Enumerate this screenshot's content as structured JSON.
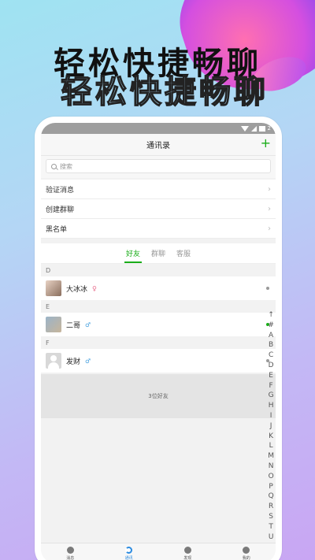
{
  "promo": {
    "headline": "轻松快捷畅聊"
  },
  "status": {
    "time": "2"
  },
  "header": {
    "title": "通讯录",
    "add_icon": "plus-icon"
  },
  "search": {
    "placeholder": "搜索"
  },
  "menu": [
    {
      "label": "验证消息"
    },
    {
      "label": "创建群聊"
    },
    {
      "label": "黑名单"
    }
  ],
  "tabs": [
    {
      "label": "好友",
      "active": true
    },
    {
      "label": "群聊",
      "active": false
    },
    {
      "label": "客服",
      "active": false
    }
  ],
  "sections": [
    {
      "letter": "D",
      "contacts": [
        {
          "name": "大冰冰",
          "gender": "female",
          "online": false
        }
      ]
    },
    {
      "letter": "E",
      "contacts": [
        {
          "name": "二哥",
          "gender": "male",
          "online": true
        }
      ]
    },
    {
      "letter": "F",
      "contacts": [
        {
          "name": "发财",
          "gender": "male",
          "online": false
        }
      ]
    }
  ],
  "friend_count": "3位好友",
  "index_letters": [
    "↑",
    "#",
    "A",
    "B",
    "C",
    "D",
    "E",
    "F",
    "G",
    "H",
    "I",
    "J",
    "K",
    "L",
    "M",
    "N",
    "O",
    "P",
    "Q",
    "R",
    "S",
    "T",
    "U"
  ],
  "bottom_nav": [
    {
      "label": "消息",
      "icon": "message-icon"
    },
    {
      "label": "通讯",
      "icon": "contacts-icon",
      "active": true
    },
    {
      "label": "发现",
      "icon": "discover-icon"
    },
    {
      "label": "我的",
      "icon": "profile-icon"
    }
  ],
  "colors": {
    "accent": "#1aad19",
    "active_tab": "#2a8be0"
  }
}
